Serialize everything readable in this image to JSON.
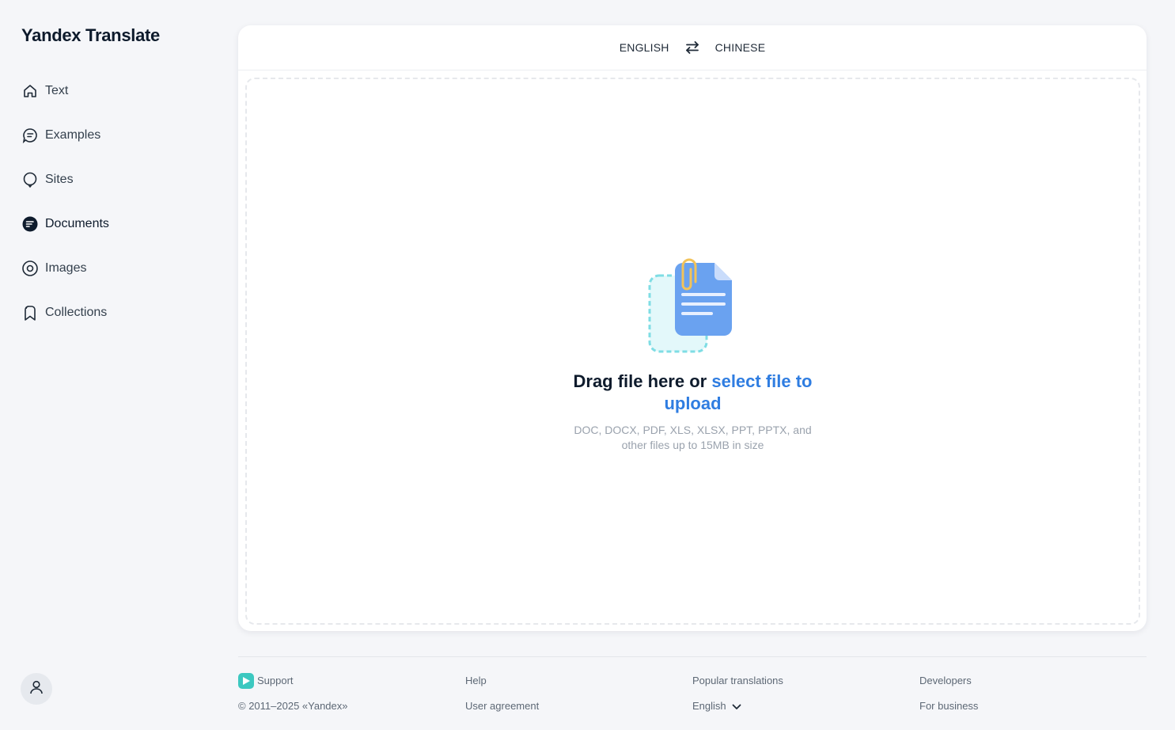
{
  "app": {
    "title": "Yandex Translate"
  },
  "sidebar": {
    "items": [
      {
        "label": "Text",
        "icon": "home-icon"
      },
      {
        "label": "Examples",
        "icon": "chat-bubble-icon"
      },
      {
        "label": "Sites",
        "icon": "globe-bubble-icon"
      },
      {
        "label": "Documents",
        "icon": "document-icon"
      },
      {
        "label": "Images",
        "icon": "camera-icon"
      },
      {
        "label": "Collections",
        "icon": "bookmarks-icon"
      }
    ],
    "active": "Documents"
  },
  "language_bar": {
    "source": "ENGLISH",
    "target": "CHINESE",
    "swap_icon": "swap-arrows-icon"
  },
  "upload": {
    "title_prefix": "Drag file here or ",
    "title_link": "select file to upload",
    "subtitle": "DOC, DOCX, PDF, XLS, XLSX, PPT, PPTX, and other files up to 15MB in size"
  },
  "footer": {
    "support": "Support",
    "copyright": "© 2011–2025 «Yandex»",
    "help": "Help",
    "user_agreement": "User agreement",
    "popular_translations": "Popular translations",
    "language_select": "English",
    "developers": "Developers",
    "for_business": "For business"
  },
  "colors": {
    "accent": "#2f7de1",
    "background": "#f5f6f9",
    "doc_blue": "#6aa2f0",
    "clip_yellow": "#f2c35a",
    "dashed_teal": "#7fdde4"
  }
}
